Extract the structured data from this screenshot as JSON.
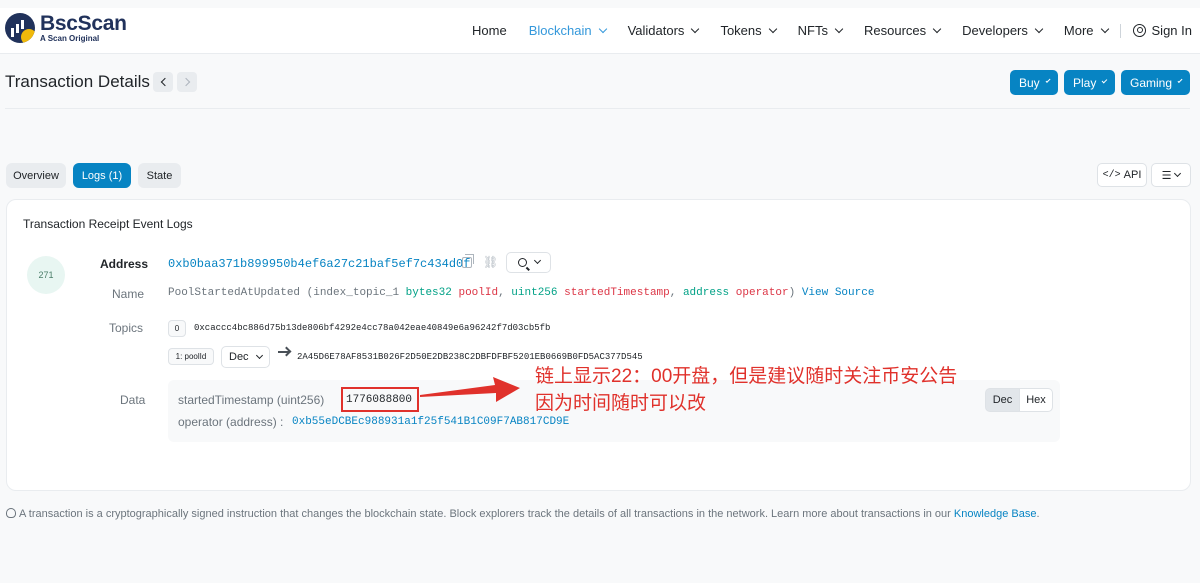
{
  "brand": {
    "name": "BscScan",
    "tagline": "A Scan Original"
  },
  "nav": {
    "home": "Home",
    "blockchain": "Blockchain",
    "validators": "Validators",
    "tokens": "Tokens",
    "nfts": "NFTs",
    "resources": "Resources",
    "developers": "Developers",
    "more": "More",
    "sign_in": "Sign In"
  },
  "page": {
    "title": "Transaction Details",
    "buttons": {
      "buy": "Buy",
      "play": "Play",
      "gaming": "Gaming"
    }
  },
  "tabs": {
    "overview": "Overview",
    "logs": "Logs (1)",
    "state": "State",
    "api": "API"
  },
  "logs": {
    "heading": "Transaction Receipt Event Logs",
    "index": "271",
    "address_label": "Address",
    "address": "0xb0baa371b899950b4ef6a27c21baf5ef7c434d0f",
    "name_label": "Name",
    "sig": {
      "fn": "PoolStartedAtUpdated",
      "open": " (index_topic_1 ",
      "t1": "bytes32",
      "p1": "poolId",
      "t2": "uint256",
      "p2": "startedTimestamp",
      "t3": "address",
      "p3": "operator",
      "close": ")",
      "view_source": "View Source"
    },
    "topics_label": "Topics",
    "topic0_index": "0",
    "topic0_value": "0xcaccc4bc886d75b13de806bf4292e4cc78a042eae40849e6a96242f7d03cb5fb",
    "topic1_index": "1: poolId",
    "topic1_format": "Dec",
    "topic1_value": "2A45D6E78AF8531B026F2D50E2DB238C2DBFDFBF5201EB0669B0FD5AC377D545",
    "data_label": "Data",
    "data": {
      "field1_name": "startedTimestamp (uint256)",
      "field1_value": "1776088800",
      "field2_name": "operator (address) : ",
      "field2_value": "0xb55eDCBEc988931a1f25f541B1C09F7AB817CD9E",
      "dec": "Dec",
      "hex": "Hex"
    }
  },
  "annotation": {
    "line1": "链上显示22：00开盘，但是建议随时关注币安公告",
    "line2": "因为时间随时可以改",
    "color": "#e0312b"
  },
  "footer": {
    "text": "A transaction is a cryptographically signed instruction that changes the blockchain state. Block explorers track the details of all transactions in the network. Learn more about transactions in our ",
    "link": "Knowledge Base",
    "end": "."
  },
  "colors": {
    "primary": "#0784c3",
    "brand_dark": "#21325b",
    "brand_gold": "#f0b90b"
  }
}
